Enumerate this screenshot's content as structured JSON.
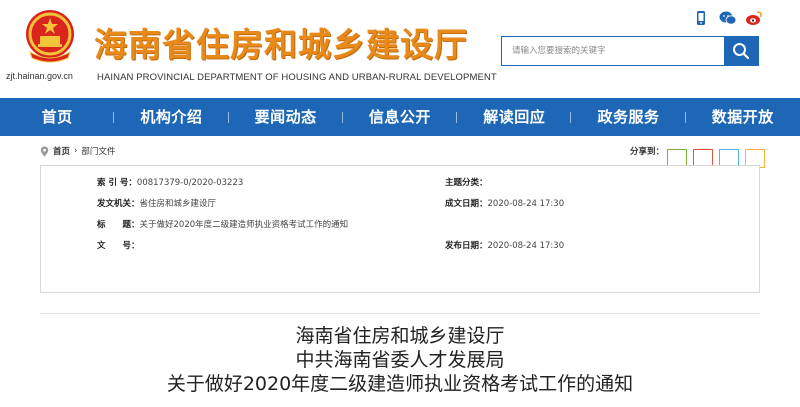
{
  "header": {
    "site_title": "海南省住房和城乡建设厅",
    "site_subtitle": "HAINAN PROVINCIAL DEPARTMENT OF HOUSING AND URBAN-RURAL DEVELOPMENT",
    "site_domain": "zjt.hainan.gov.cn",
    "search_placeholder": "请输入您要搜索的关键字",
    "icons": [
      "mobile-icon",
      "wechat-icon",
      "weibo-icon"
    ],
    "accent_color": "#1d67b6",
    "title_color": "#e88a1a"
  },
  "nav": {
    "items": [
      "首页",
      "机构介绍",
      "要闻动态",
      "信息公开",
      "解读回应",
      "政务服务",
      "数据开放"
    ]
  },
  "breadcrumb": {
    "home": "首页",
    "separator": "›",
    "current": "部门文件",
    "share_label": "分享到："
  },
  "share_colors": [
    "#7bb33d",
    "#e2573b",
    "#52b6e0",
    "#f1b63b"
  ],
  "info": {
    "index_label": "索 引 号：",
    "index_value": "00817379-0/2020-03223",
    "category_label": "主题分类：",
    "category_value": "",
    "issuer_label": "发文机关：",
    "issuer_value": "省住房和城乡建设厅",
    "created_label": "成文日期：",
    "created_value": "2020-08-24 17:30",
    "title_label": "标　　题：",
    "title_value": "关于做好2020年度二级建造师执业资格考试工作的通知",
    "doc_no_label": "文　　号：",
    "doc_no_value": "",
    "published_label": "发布日期：",
    "published_value": "2020-08-24 17:30"
  },
  "article": {
    "title_lines": [
      "海南省住房和城乡建设厅",
      "中共海南省委人才发展局",
      "关于做好2020年度二级建造师执业资格考试工作的通知"
    ]
  }
}
